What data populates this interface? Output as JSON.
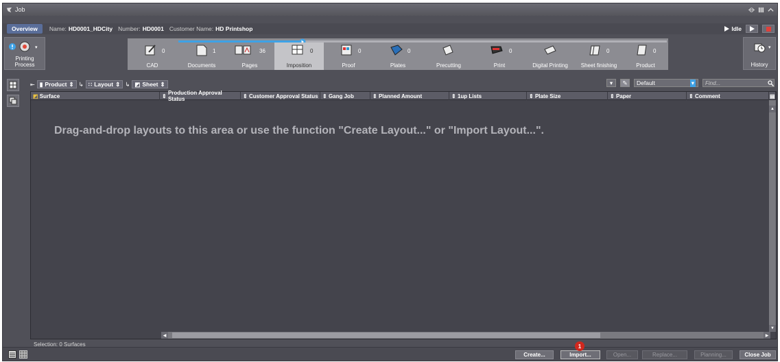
{
  "window": {
    "title": "Job"
  },
  "infobar": {
    "overview_tab": "Overview",
    "name_label": "Name:",
    "name_value": "HD0001_HDCity",
    "number_label": "Number:",
    "number_value": "HD0001",
    "customer_label": "Customer Name:",
    "customer_value": "HD Printshop",
    "status": "Idle"
  },
  "workflow": {
    "left_label": "Printing Process",
    "right_label": "History",
    "steps": [
      {
        "name": "CAD",
        "count": "0"
      },
      {
        "name": "Documents",
        "count": "1"
      },
      {
        "name": "Pages",
        "count": "36"
      },
      {
        "name": "Imposition",
        "count": "0"
      },
      {
        "name": "Proof",
        "count": "0"
      },
      {
        "name": "Plates",
        "count": "0"
      },
      {
        "name": "Precutting",
        "count": ""
      },
      {
        "name": "Print",
        "count": "0"
      },
      {
        "name": "Digital Printing",
        "count": ""
      },
      {
        "name": "Sheet finishing",
        "count": "0"
      },
      {
        "name": "Product",
        "count": "0"
      }
    ]
  },
  "grouping": {
    "product": "Product",
    "layout": "Layout",
    "sheet": "Sheet"
  },
  "filter": {
    "preset": "Default",
    "find_placeholder": "Find..."
  },
  "table": {
    "columns": [
      "Surface",
      "Production Approval Status",
      "Customer Approval Status",
      "Gang Job",
      "Planned Amount",
      "1up Lists",
      "Plate Size",
      "Paper",
      "Comment"
    ],
    "empty_message": "Drag-and-drop layouts to this area or use the function \"Create Layout...\" or \"Import Layout...\"."
  },
  "selection_text": "Selection:  0 Surfaces",
  "buttons": {
    "create": "Create...",
    "import": "Import...",
    "open": "Open...",
    "replace": "Replace...",
    "planning": "Planning...",
    "close_job": "Close Job"
  },
  "badge": "1",
  "colors": {
    "accent": "#3ea2e6",
    "panel": "#505058",
    "badge": "#d0281e"
  }
}
